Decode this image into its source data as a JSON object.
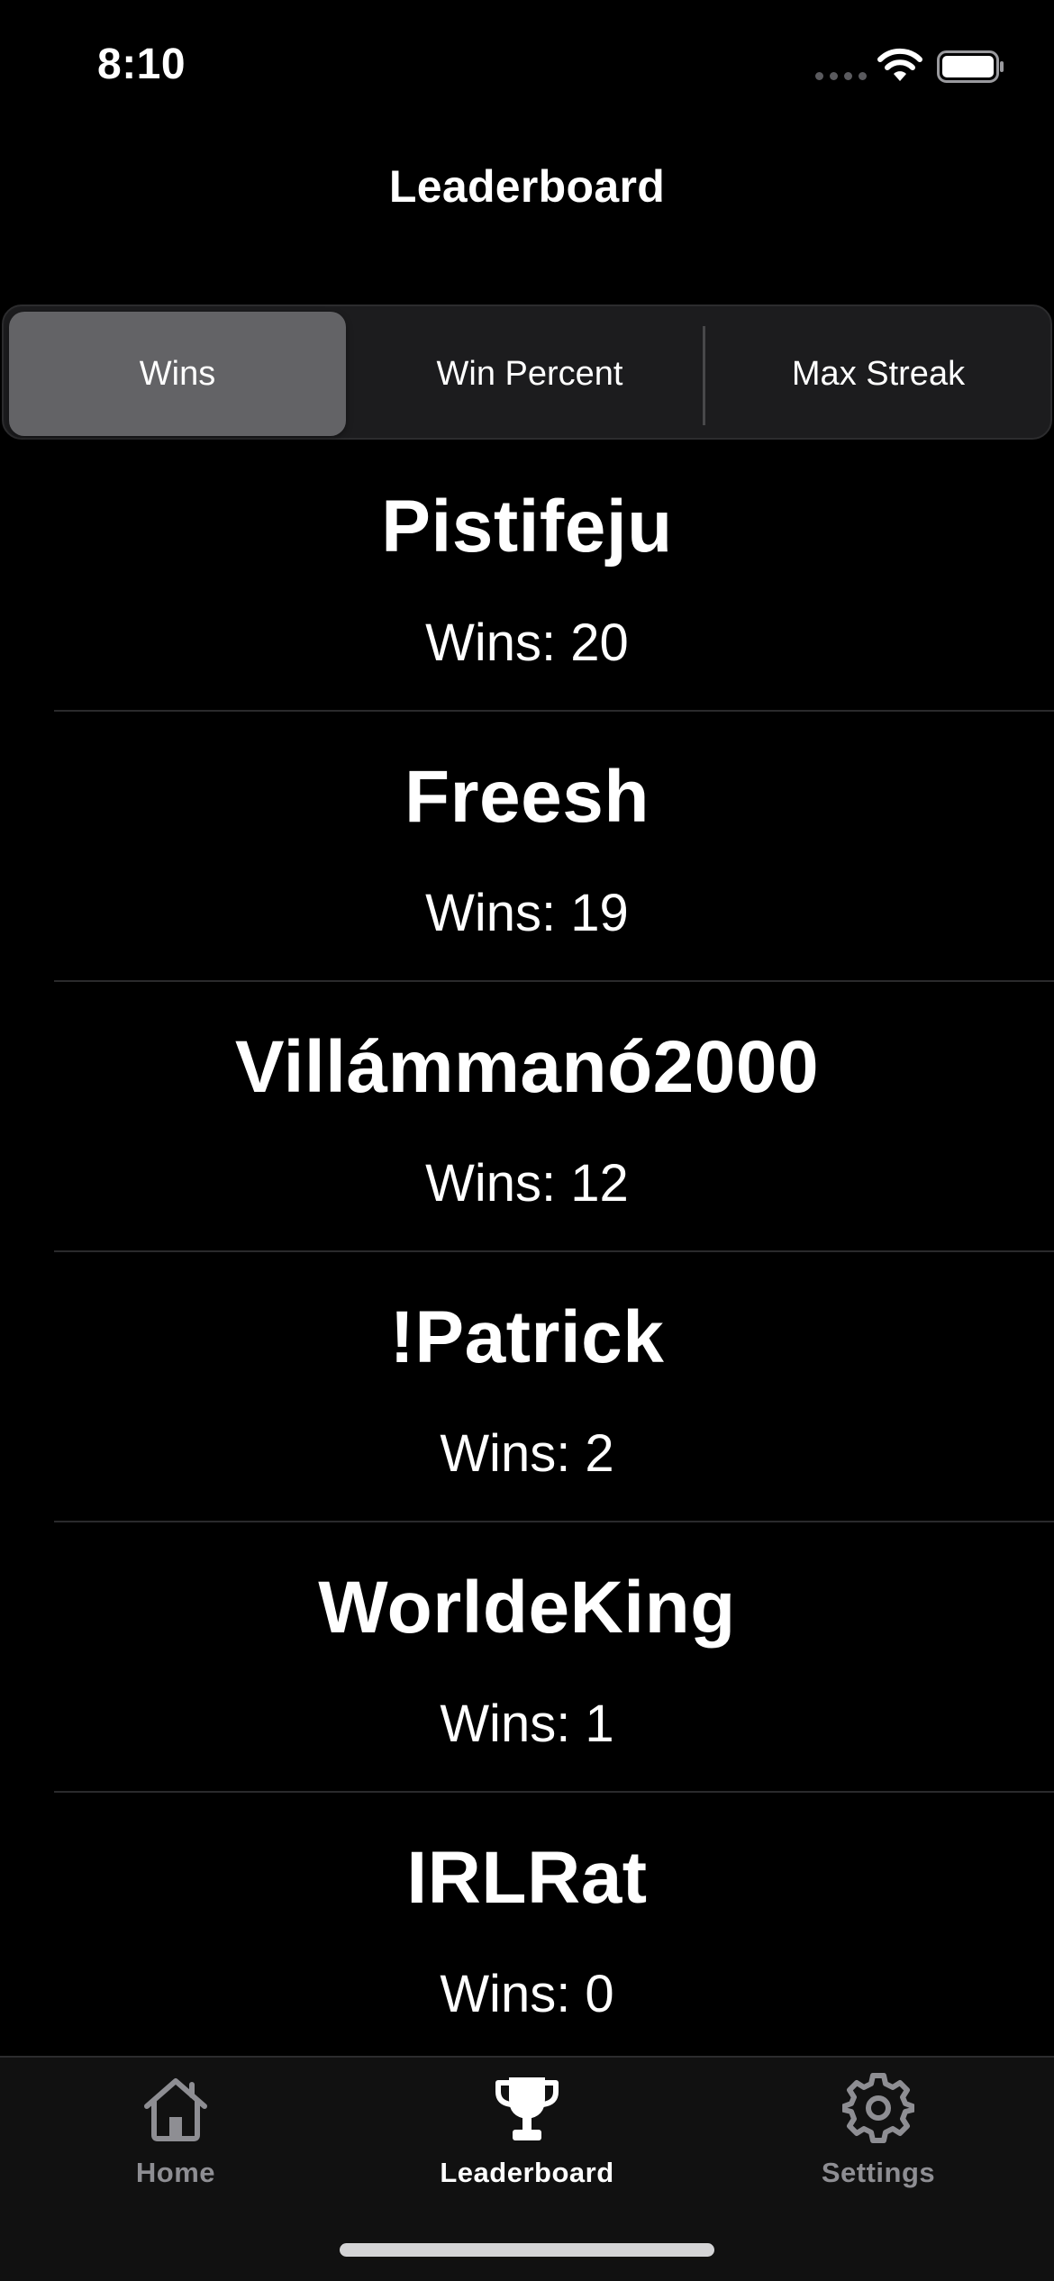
{
  "status_bar": {
    "time": "8:10"
  },
  "nav": {
    "title": "Leaderboard"
  },
  "segmented_control": {
    "selected_index": 0,
    "segments": [
      "Wins",
      "Win Percent",
      "Max Streak"
    ]
  },
  "leaderboard": {
    "entries": [
      {
        "name": "Pistifeju",
        "stat": "Wins: 20"
      },
      {
        "name": "Freesh",
        "stat": "Wins: 19"
      },
      {
        "name": "Villámmanó2000",
        "stat": "Wins: 12"
      },
      {
        "name": "!Patrick",
        "stat": "Wins: 2"
      },
      {
        "name": "WorldeKing",
        "stat": "Wins: 1"
      },
      {
        "name": "IRLRat",
        "stat": "Wins: 0"
      }
    ]
  },
  "tab_bar": {
    "active": "leaderboard",
    "tabs": [
      {
        "label": "Home",
        "icon": "house-icon"
      },
      {
        "label": "Leaderboard",
        "icon": "trophy-icon"
      },
      {
        "label": "Settings",
        "icon": "gear-icon"
      }
    ]
  },
  "colors": {
    "background": "#000000",
    "segment_selected": "#636366",
    "tab_inactive": "#8e8e93",
    "tab_active": "#ffffff"
  }
}
